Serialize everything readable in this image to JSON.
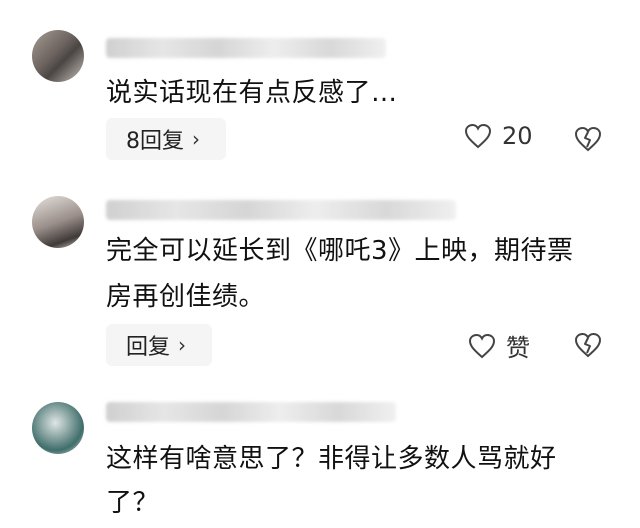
{
  "comments": [
    {
      "text": "说实话现在有点反感了…",
      "reply_label": "8回复",
      "like_count": "20"
    },
    {
      "text_line1": "完全可以延长到《哪吒3》上映，期待票",
      "text_line2": "房再创佳绩。",
      "reply_label": "回复",
      "like_count": "赞"
    },
    {
      "text_line1": "这样有啥意思了？非得让多数人骂就好",
      "text_line2": "了？"
    }
  ],
  "icons": {
    "like": "heart-outline-icon",
    "dislike": "broken-heart-icon",
    "reply_chevron": "chevron-right-icon"
  }
}
